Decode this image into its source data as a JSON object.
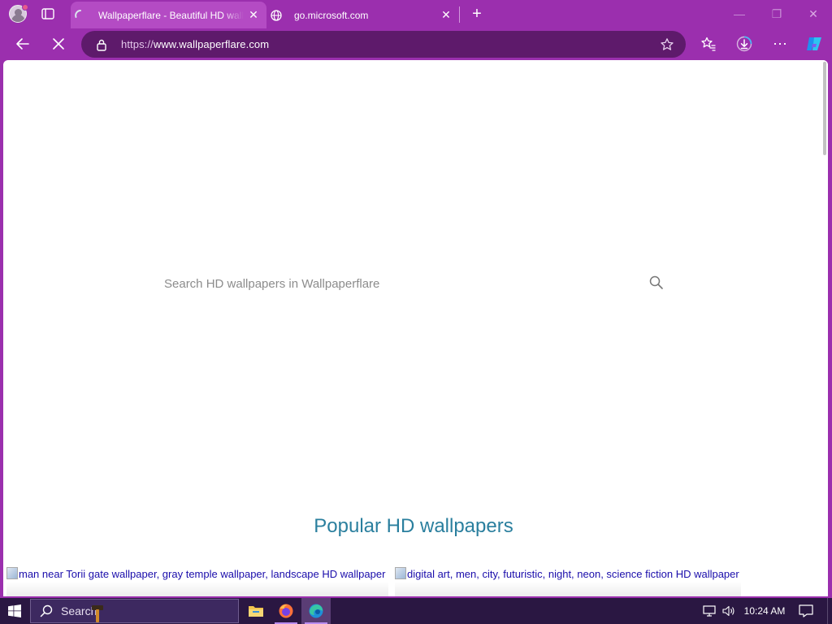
{
  "browser": {
    "tabs": [
      {
        "title": "Wallpaperflare - Beautiful HD wallpapers",
        "active": true,
        "loading": true
      },
      {
        "title": "go.microsoft.com",
        "active": false,
        "loading": false
      }
    ],
    "close_glyph": "✕",
    "new_tab_glyph": "+",
    "window_controls": {
      "minimize": "—",
      "maximize": "❐",
      "close": "✕"
    },
    "address": {
      "protocol": "https://",
      "host": "www.wallpaperflare.com"
    },
    "more_glyph": "⋯",
    "accent_color": "#9b2fae"
  },
  "page": {
    "search_placeholder": "Search HD wallpapers in Wallpaperflare",
    "popular_heading": "Popular HD wallpapers",
    "thumbnails": [
      {
        "alt": "man near Torii gate wallpaper, gray temple wallpaper, landscape HD wallpaper"
      },
      {
        "alt": "digital art, men, city, futuristic, night, neon, science fiction HD wallpaper"
      }
    ]
  },
  "taskbar": {
    "search_label": "Search",
    "clock": "10:24 AM",
    "pinned": [
      "file-explorer",
      "firefox",
      "edge"
    ]
  }
}
